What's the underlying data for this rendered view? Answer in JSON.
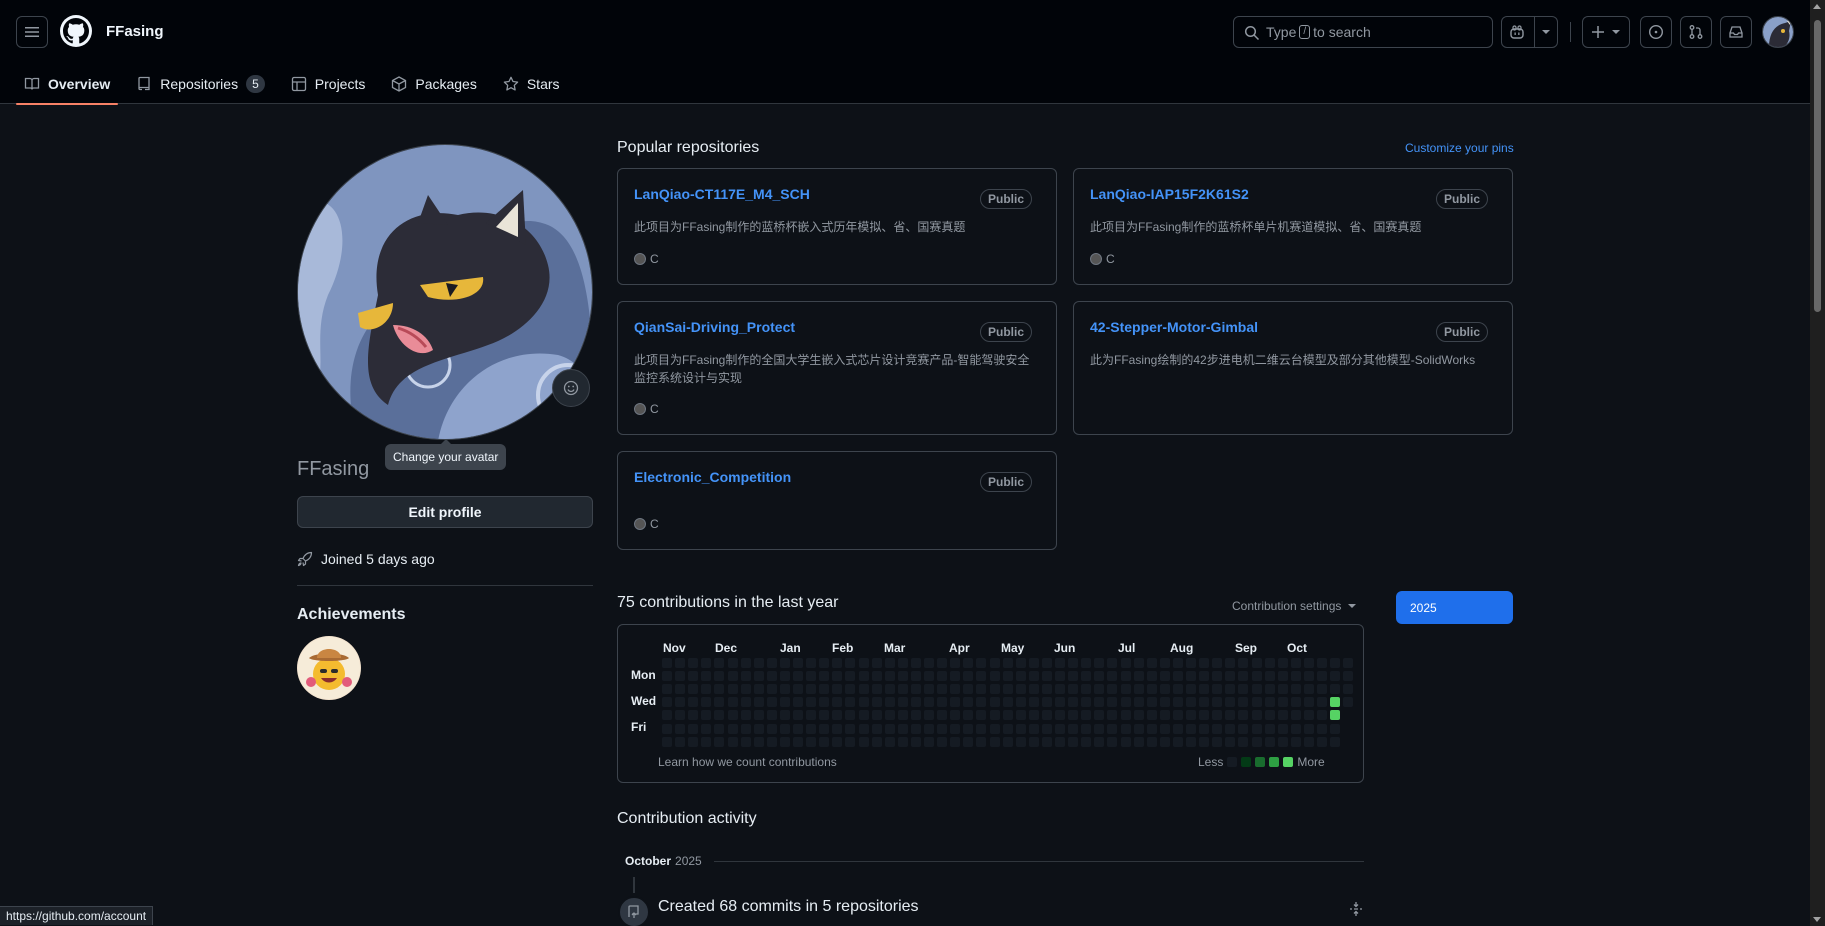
{
  "header": {
    "owner": "FFasing",
    "search_prefix": "Type",
    "search_key": "/",
    "search_suffix": "to search"
  },
  "tabs": [
    {
      "label": "Overview"
    },
    {
      "label": "Repositories",
      "count": "5"
    },
    {
      "label": "Projects"
    },
    {
      "label": "Packages"
    },
    {
      "label": "Stars"
    }
  ],
  "sidebar": {
    "tooltip": "Change your avatar",
    "username": "FFasing",
    "edit_label": "Edit profile",
    "joined": "Joined 5 days ago",
    "achievements_title": "Achievements"
  },
  "popular": {
    "title": "Popular repositories",
    "customize": "Customize your pins",
    "repos": [
      {
        "name": "LanQiao-CT117E_M4_SCH",
        "visibility": "Public",
        "desc": "此项目为FFasing制作的蓝桥杯嵌入式历年模拟、省、国赛真题",
        "lang": "C"
      },
      {
        "name": "LanQiao-IAP15F2K61S2",
        "visibility": "Public",
        "desc": "此项目为FFasing制作的蓝桥杯单片机赛道模拟、省、国赛真题",
        "lang": "C"
      },
      {
        "name": "QianSai-Driving_Protect",
        "visibility": "Public",
        "desc": "此项目为FFasing制作的全国大学生嵌入式芯片设计竞赛产品-智能驾驶安全监控系统设计与实现",
        "lang": "C"
      },
      {
        "name": "42-Stepper-Motor-Gimbal",
        "visibility": "Public",
        "desc": "此为FFasing绘制的42步进电机二维云台模型及部分其他模型-SolidWorks",
        "lang": ""
      },
      {
        "name": "Electronic_Competition",
        "visibility": "Public",
        "desc": "",
        "lang": "C"
      }
    ]
  },
  "contributions": {
    "title": "75 contributions in the last year",
    "settings": "Contribution settings",
    "year": "2025",
    "months": [
      "Nov",
      "Dec",
      "Jan",
      "Feb",
      "Mar",
      "Apr",
      "May",
      "Jun",
      "Jul",
      "Aug",
      "Sep",
      "Oct"
    ],
    "days": [
      "Mon",
      "Wed",
      "Fri"
    ],
    "learn": "Learn how we count contributions",
    "less": "Less",
    "more": "More"
  },
  "activity": {
    "title": "Contribution activity",
    "month": "October",
    "year": "2025",
    "item": "Created 68 commits in 5 repositories"
  },
  "status_url": "https://github.com/account"
}
